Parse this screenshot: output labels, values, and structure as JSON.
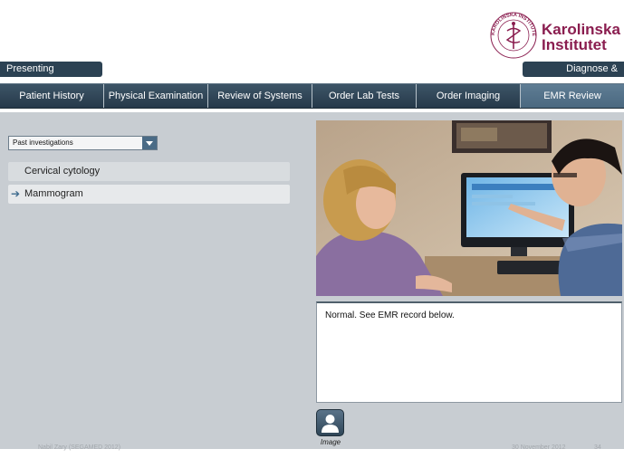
{
  "logo": {
    "line1": "Karolinska",
    "line2": "Institutet",
    "seal_text": "KAROLINSKA INSTITUTET",
    "brand_color": "#8a1d4f"
  },
  "header": {
    "left_pill": "Presenting Complaint",
    "right_pill": "Diagnose & Manage Pt."
  },
  "nav": {
    "tabs": [
      {
        "label": "Patient History"
      },
      {
        "label": "Physical Examination"
      },
      {
        "label": "Review of Systems"
      },
      {
        "label": "Order Lab Tests"
      },
      {
        "label": "Order Imaging"
      },
      {
        "label": "EMR Review"
      }
    ],
    "active_tab": "EMR Review"
  },
  "panel": {
    "dropdown": {
      "selected": "Past investigations"
    },
    "items": [
      {
        "label": "Cervical cytology"
      },
      {
        "label": "Mammogram"
      }
    ],
    "selected_item": "Mammogram",
    "result_text": "Normal.  See EMR record below.",
    "image_button_label": "Image"
  },
  "footer": {
    "author": "Nabil Zary (SEGAMED  2012)",
    "date": "30 November 2012",
    "page": "34"
  }
}
